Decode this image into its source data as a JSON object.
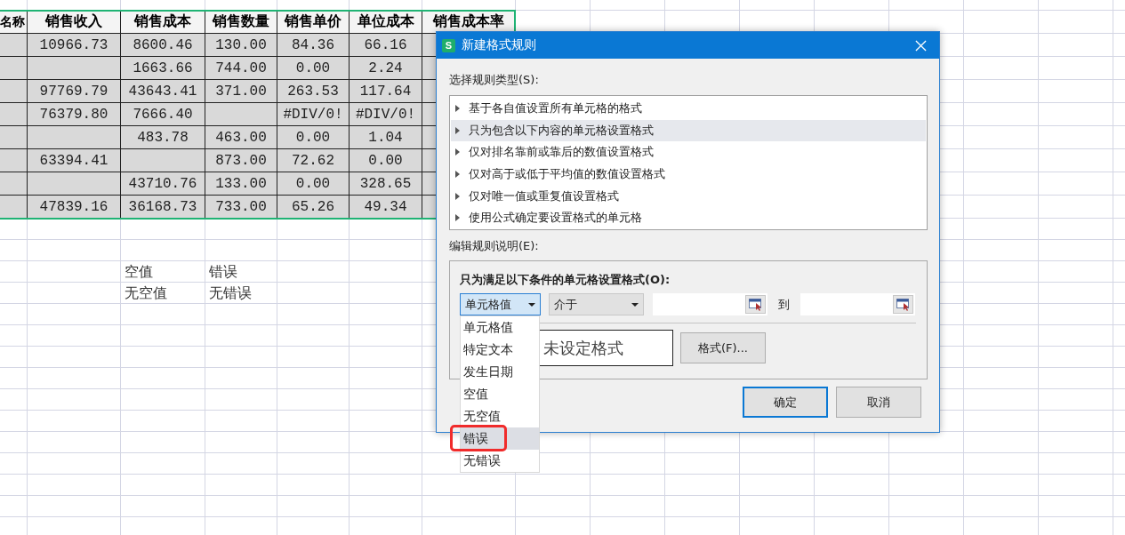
{
  "sheet": {
    "columns": [
      "名称",
      "销售收入",
      "销售成本",
      "销售数量",
      "销售单价",
      "单位成本",
      "销售成本率"
    ],
    "rows": [
      [
        "",
        "10966.73",
        "8600.46",
        "130.00",
        "84.36",
        "66.16"
      ],
      [
        "",
        "",
        "1663.66",
        "744.00",
        "0.00",
        "2.24"
      ],
      [
        "",
        "97769.79",
        "43643.41",
        "371.00",
        "263.53",
        "117.64"
      ],
      [
        "",
        "76379.80",
        "7666.40",
        "",
        "#DIV/0!",
        "#DIV/0!"
      ],
      [
        "",
        "",
        "483.78",
        "463.00",
        "0.00",
        "1.04"
      ],
      [
        "",
        "63394.41",
        "",
        "873.00",
        "72.62",
        "0.00"
      ],
      [
        "",
        "",
        "43710.76",
        "133.00",
        "0.00",
        "328.65"
      ],
      [
        "",
        "47839.16",
        "36168.73",
        "733.00",
        "65.26",
        "49.34"
      ]
    ],
    "notes": [
      [
        "空值",
        "错误"
      ],
      [
        "无空值",
        "无错误"
      ]
    ]
  },
  "dialog": {
    "app_icon": "S",
    "title": "新建格式规则",
    "rule_type_label": "选择规则类型(S):",
    "rule_types": [
      {
        "label": "基于各自值设置所有单元格的格式",
        "selected": false
      },
      {
        "label": "只为包含以下内容的单元格设置格式",
        "selected": true
      },
      {
        "label": "仅对排名靠前或靠后的数值设置格式",
        "selected": false
      },
      {
        "label": "仅对高于或低于平均值的数值设置格式",
        "selected": false
      },
      {
        "label": "仅对唯一值或重复值设置格式",
        "selected": false
      },
      {
        "label": "使用公式确定要设置格式的单元格",
        "selected": false
      }
    ],
    "description_label": "编辑规则说明(E):",
    "condition_heading": "只为满足以下条件的单元格设置格式(O):",
    "condition_field": {
      "value": "单元格值",
      "expanded": true,
      "options": [
        {
          "label": "单元格值",
          "hovered": false,
          "highlighted": false
        },
        {
          "label": "特定文本",
          "hovered": false,
          "highlighted": false
        },
        {
          "label": "发生日期",
          "hovered": false,
          "highlighted": false
        },
        {
          "label": "空值",
          "hovered": false,
          "highlighted": false
        },
        {
          "label": "无空值",
          "hovered": false,
          "highlighted": false
        },
        {
          "label": "错误",
          "hovered": true,
          "highlighted": true
        },
        {
          "label": "无错误",
          "hovered": false,
          "highlighted": false
        }
      ]
    },
    "operator_field": {
      "value": "介于"
    },
    "range_separator": "到",
    "preview": "未设定格式",
    "format_button": "格式(F)...",
    "buttons": [
      {
        "label": "确定",
        "default": true
      },
      {
        "label": "取消",
        "default": false
      }
    ]
  }
}
